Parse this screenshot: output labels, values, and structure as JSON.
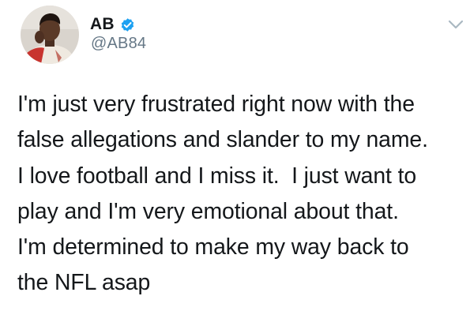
{
  "tweet": {
    "author": {
      "display_name": "AB",
      "handle": "@AB84",
      "verified": true
    },
    "icons": {
      "verified": "verified-badge-icon",
      "menu": "chevron-down-icon"
    },
    "text": "I'm just very frustrated right now with the\nfalse allegations and slander to my name.\nI love football and I miss it.  I just want to\nplay and I'm very emotional about that.\nI'm determined to make my way back to\nthe NFL asap"
  },
  "colors": {
    "verified": "#1da1f2",
    "handle": "#657786",
    "text": "#14171a",
    "chevron": "#aab8c2"
  }
}
